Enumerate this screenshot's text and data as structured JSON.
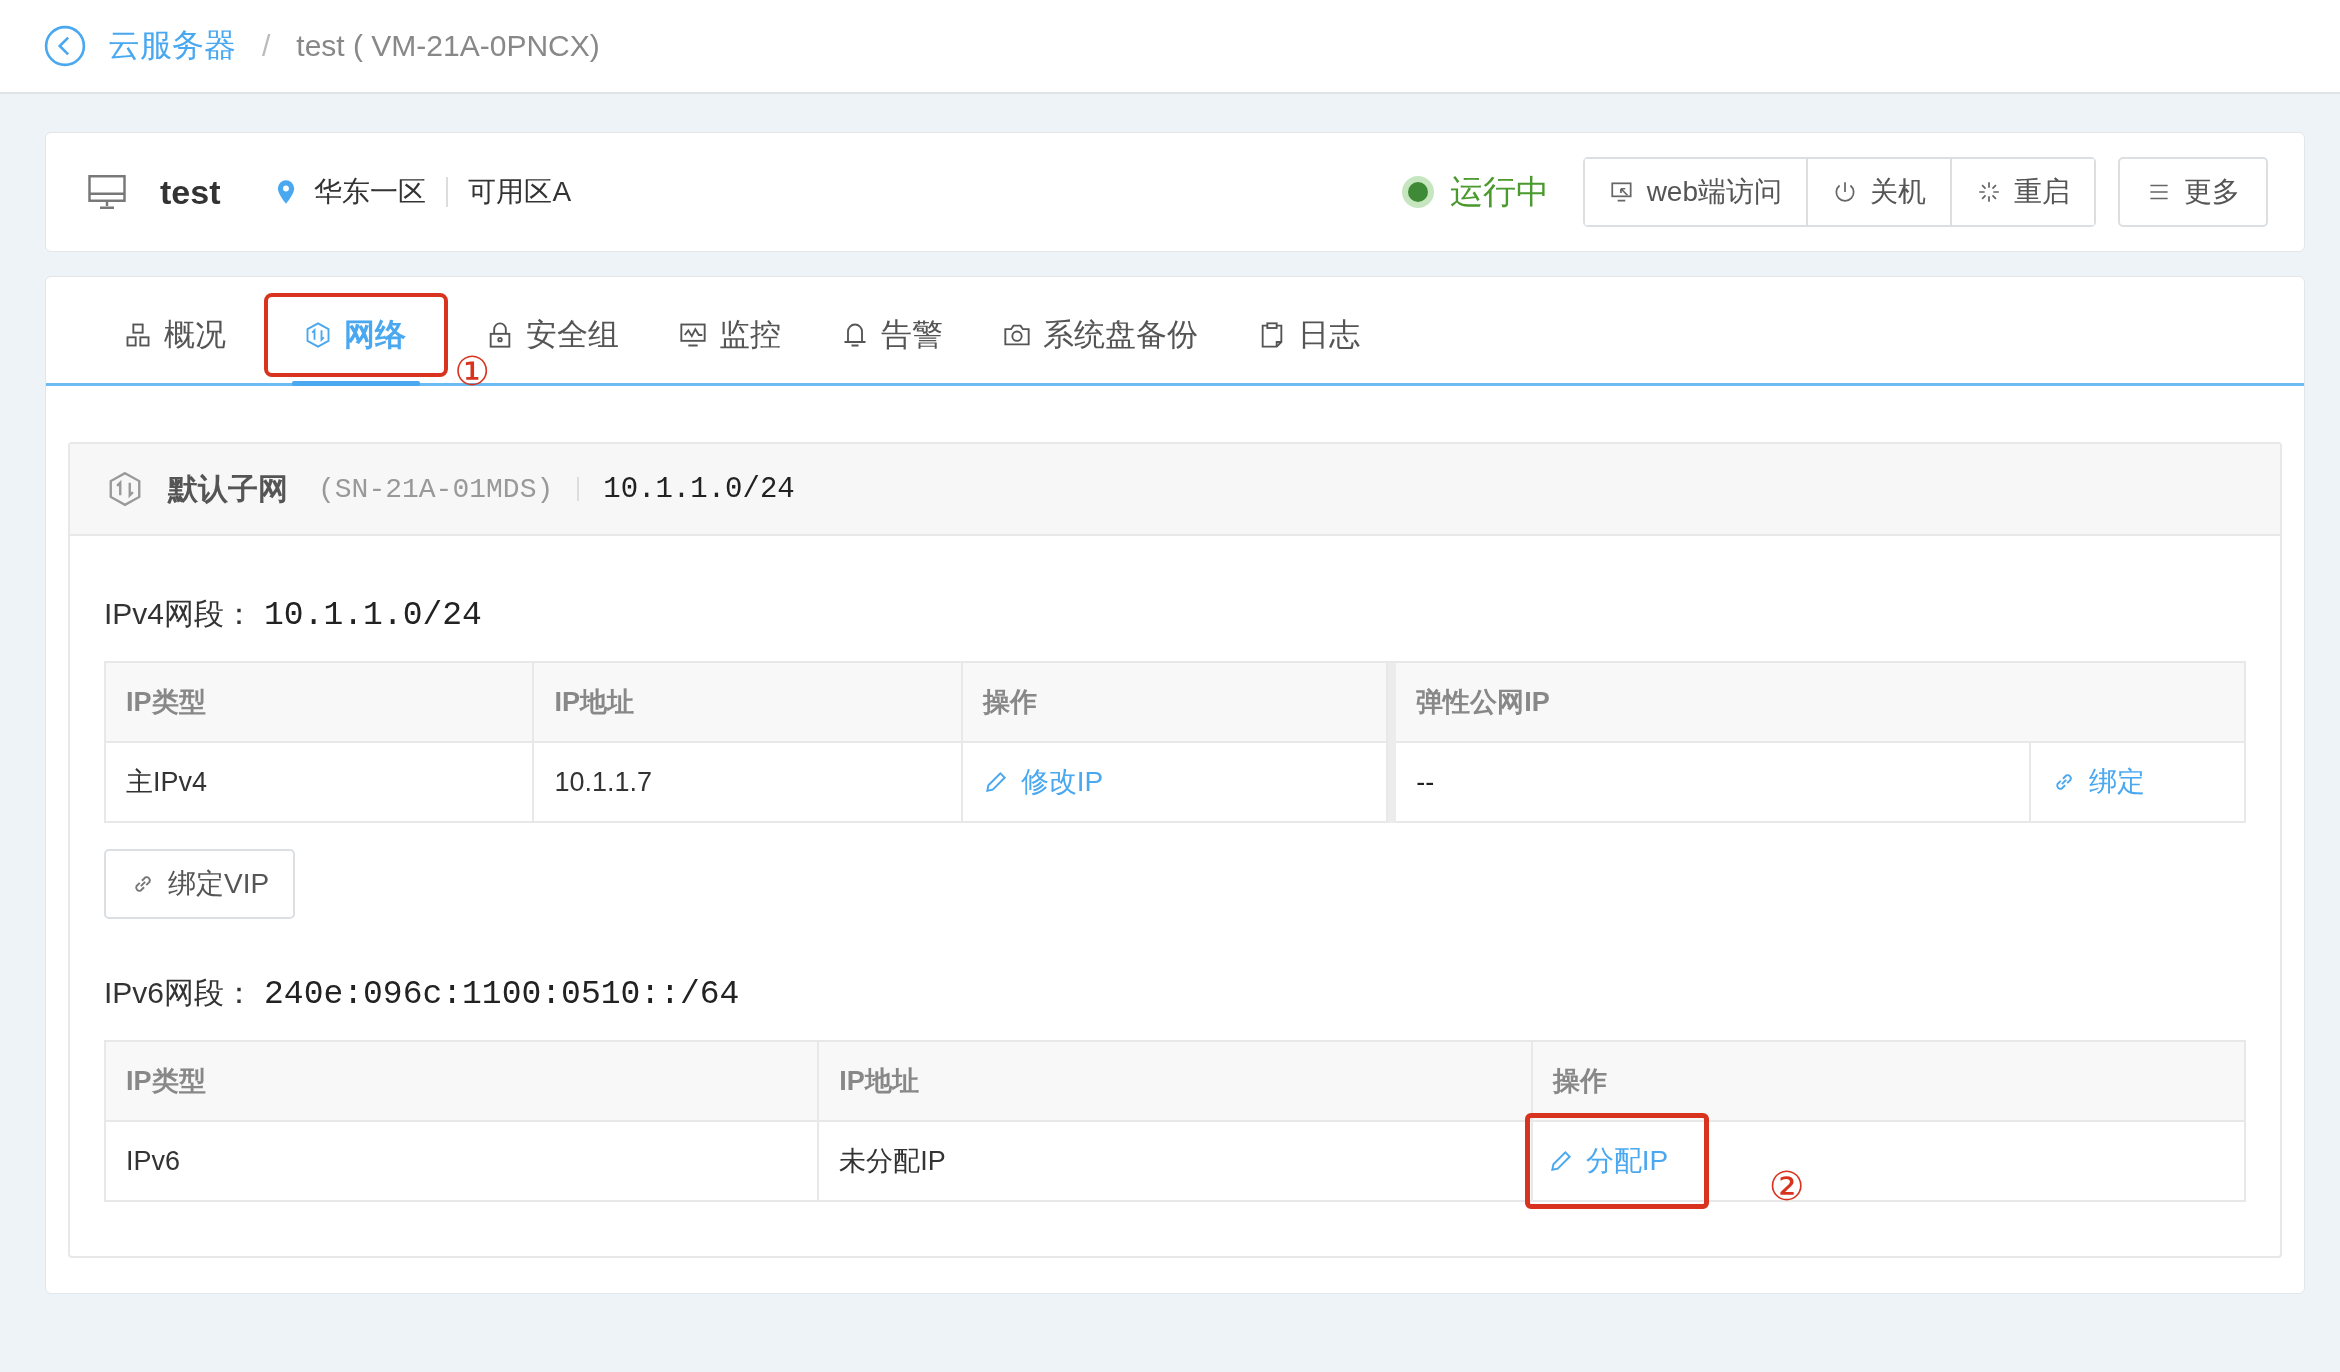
{
  "breadcrumb": {
    "parent": "云服务器",
    "separator": "/",
    "current": "test ( VM-21A-0PNCX)"
  },
  "instance": {
    "name": "test",
    "region": "华东一区",
    "zone": "可用区A",
    "status": "运行中",
    "running": true
  },
  "actions": [
    {
      "label": "web端访问",
      "kind": "console"
    },
    {
      "label": "关机",
      "kind": "power"
    },
    {
      "label": "重启",
      "kind": "restart"
    }
  ],
  "more": {
    "label": "更多"
  },
  "tabs": [
    {
      "label": "概况",
      "kind": "overview",
      "selected": false,
      "highlighted": false
    },
    {
      "label": "网络",
      "kind": "network",
      "selected": true,
      "highlighted": true,
      "marker": "①"
    },
    {
      "label": "安全组",
      "kind": "lock",
      "selected": false,
      "highlighted": false
    },
    {
      "label": "监控",
      "kind": "monitor",
      "selected": false,
      "highlighted": false
    },
    {
      "label": "告警",
      "kind": "bell",
      "selected": false,
      "highlighted": false
    },
    {
      "label": "系统盘备份",
      "kind": "camera",
      "selected": false,
      "highlighted": false
    },
    {
      "label": "日志",
      "kind": "clipboard",
      "selected": false,
      "highlighted": false
    }
  ],
  "subnet": {
    "name": "默认子网",
    "id": "(SN-21A-01MDS)",
    "cidr": "10.1.1.0/24"
  },
  "ipv4": {
    "label": "IPv4网段：",
    "cidr": "10.1.1.0/24",
    "columns": [
      "IP类型",
      "IP地址",
      "操作",
      "弹性公网IP"
    ],
    "rows": [
      {
        "type": "主IPv4",
        "address": "10.1.1.7",
        "action": "修改IP",
        "eip": "--",
        "eip_action": "绑定"
      }
    ],
    "bind_vip": "绑定VIP"
  },
  "ipv6": {
    "label": "IPv6网段：",
    "cidr": "240e:096c:1100:0510::/64",
    "columns": [
      "IP类型",
      "IP地址",
      "操作"
    ],
    "rows": [
      {
        "type": "IPv6",
        "address": "未分配IP",
        "action": "分配IP",
        "highlighted": true,
        "marker": "②"
      }
    ]
  }
}
